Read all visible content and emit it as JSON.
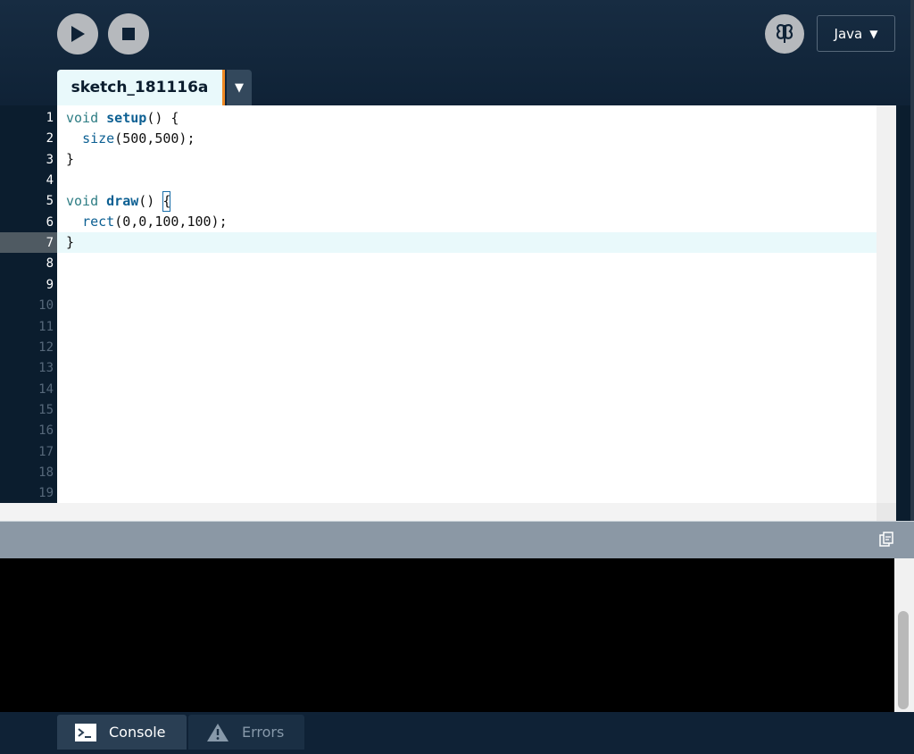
{
  "toolbar": {
    "run_icon": "play-icon",
    "stop_icon": "stop-icon",
    "mode_icon": "butterfly-icon",
    "mode_label": "Java",
    "mode_arrow": "▼"
  },
  "tab": {
    "name": "sketch_181116a",
    "menu_arrow": "▼"
  },
  "editor": {
    "line_numbers": [
      "1",
      "2",
      "3",
      "4",
      "5",
      "6",
      "7",
      "8",
      "9",
      "10",
      "11",
      "12",
      "13",
      "14",
      "15",
      "16",
      "17",
      "18",
      "19"
    ],
    "current_line": 7,
    "code": {
      "l1_kw": "void ",
      "l1_fn": "setup",
      "l1_rest": "() {",
      "l2_indent": "  ",
      "l2_fn": "size",
      "l2_rest": "(500,500);",
      "l3": "}",
      "l5_kw": "void ",
      "l5_fn": "draw",
      "l5_rest": "() ",
      "l5_brace": "{",
      "l6_indent": "  ",
      "l6_fn": "rect",
      "l6_rest": "(0,0,100,100);",
      "l7": "}"
    }
  },
  "console": {
    "copy_icon": "copy-icon"
  },
  "footer": {
    "console_label": "Console",
    "console_icon": "terminal-icon",
    "errors_label": "Errors",
    "errors_icon": "warning-icon"
  },
  "colors": {
    "background": "#0b1d2e",
    "tab_accent": "#f08a24",
    "keyword": "#2e7d84",
    "function": "#0d6093",
    "current_line": "#e9f9fb"
  }
}
